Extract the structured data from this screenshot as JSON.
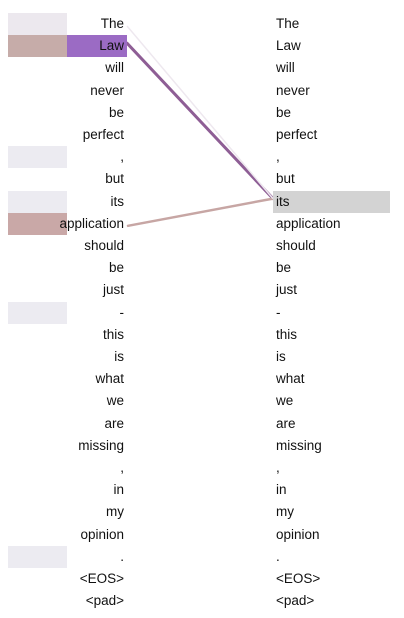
{
  "tokens": [
    "The",
    "Law",
    "will",
    "never",
    "be",
    "perfect",
    ",",
    "but",
    "its",
    "application",
    "should",
    "be",
    "just",
    "-",
    "this",
    "is",
    "what",
    "we",
    "are",
    "missing",
    ",",
    "in",
    "my",
    "opinion",
    ".",
    "<EOS>",
    "<pad>"
  ],
  "selection": {
    "side": "right",
    "token_index": 8,
    "token": "its",
    "highlight_color": "#d3d3d3"
  },
  "attention": [
    {
      "source_index": 1,
      "source": "Law",
      "weight": 0.9,
      "color": "#9b6bb5"
    },
    {
      "source_index": 9,
      "source": "application",
      "weight": 0.55,
      "color": "#c4a8a4"
    },
    {
      "source_index": 0,
      "source": "The",
      "weight": 0.04,
      "color": "#ece8ee"
    },
    {
      "source_index": 6,
      "source": ",",
      "weight": 0.03,
      "color": "#ecebf1"
    },
    {
      "source_index": 8,
      "source": "its",
      "weight": 0.03,
      "color": "#ecebf1"
    },
    {
      "source_index": 13,
      "source": "-",
      "weight": 0.03,
      "color": "#ecebf1"
    },
    {
      "source_index": 24,
      "source": ".",
      "weight": 0.03,
      "color": "#ecebf1"
    }
  ],
  "colors": {
    "line_primary": "#8e5e95",
    "line_secondary": "#c7a6a4",
    "row_bar_law": "#c6aca9",
    "row_bar_application": "#c9a8a7",
    "token_highlight_law": "#9b6bc4"
  }
}
